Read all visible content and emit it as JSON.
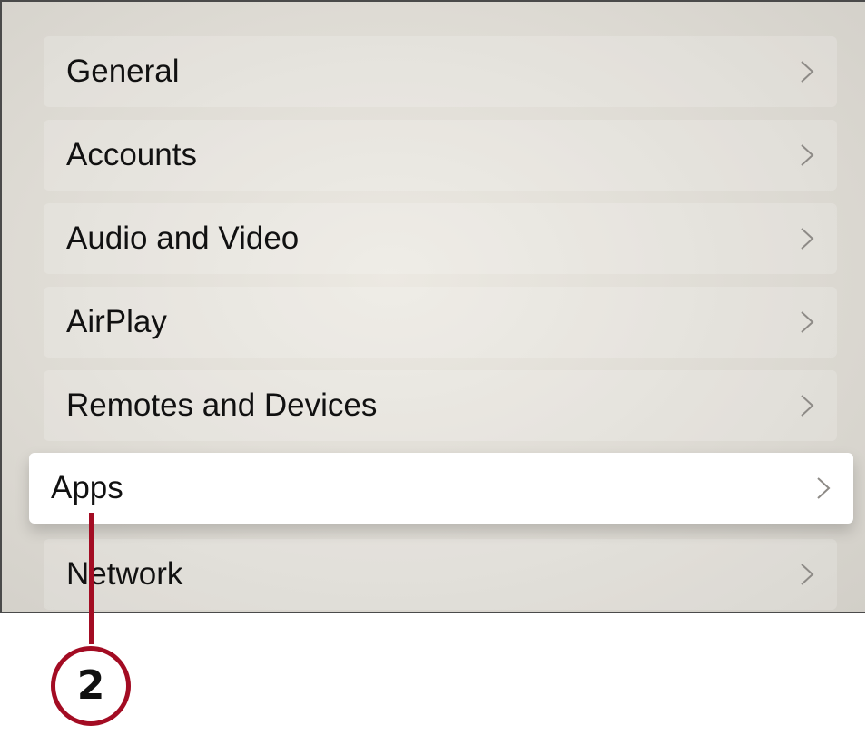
{
  "settings_menu": {
    "items": [
      {
        "label": "General"
      },
      {
        "label": "Accounts"
      },
      {
        "label": "Audio and Video"
      },
      {
        "label": "AirPlay"
      },
      {
        "label": "Remotes and Devices"
      },
      {
        "label": "Apps"
      },
      {
        "label": "Network"
      }
    ],
    "selected_index": 5
  },
  "callout": {
    "number": "2",
    "color": "#a30c23"
  },
  "icons": {
    "chevron": "chevron-right-icon"
  }
}
